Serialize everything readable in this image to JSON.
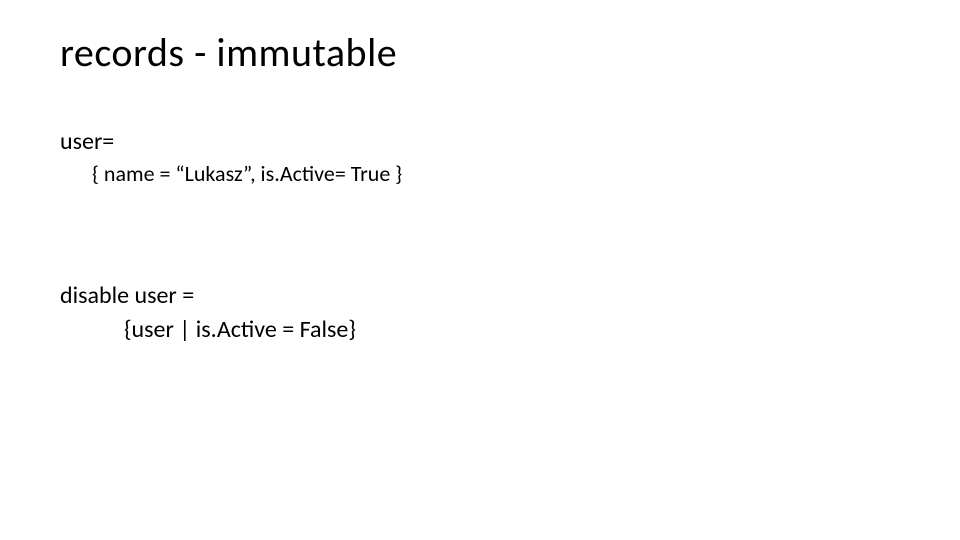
{
  "title": "records - immutable",
  "block1": {
    "line1": "user=",
    "line2": "{ name = “Lukasz”, is.Active= True }"
  },
  "block2": {
    "line1": "disable user =",
    "line2": "{user | is.Active = False}"
  }
}
